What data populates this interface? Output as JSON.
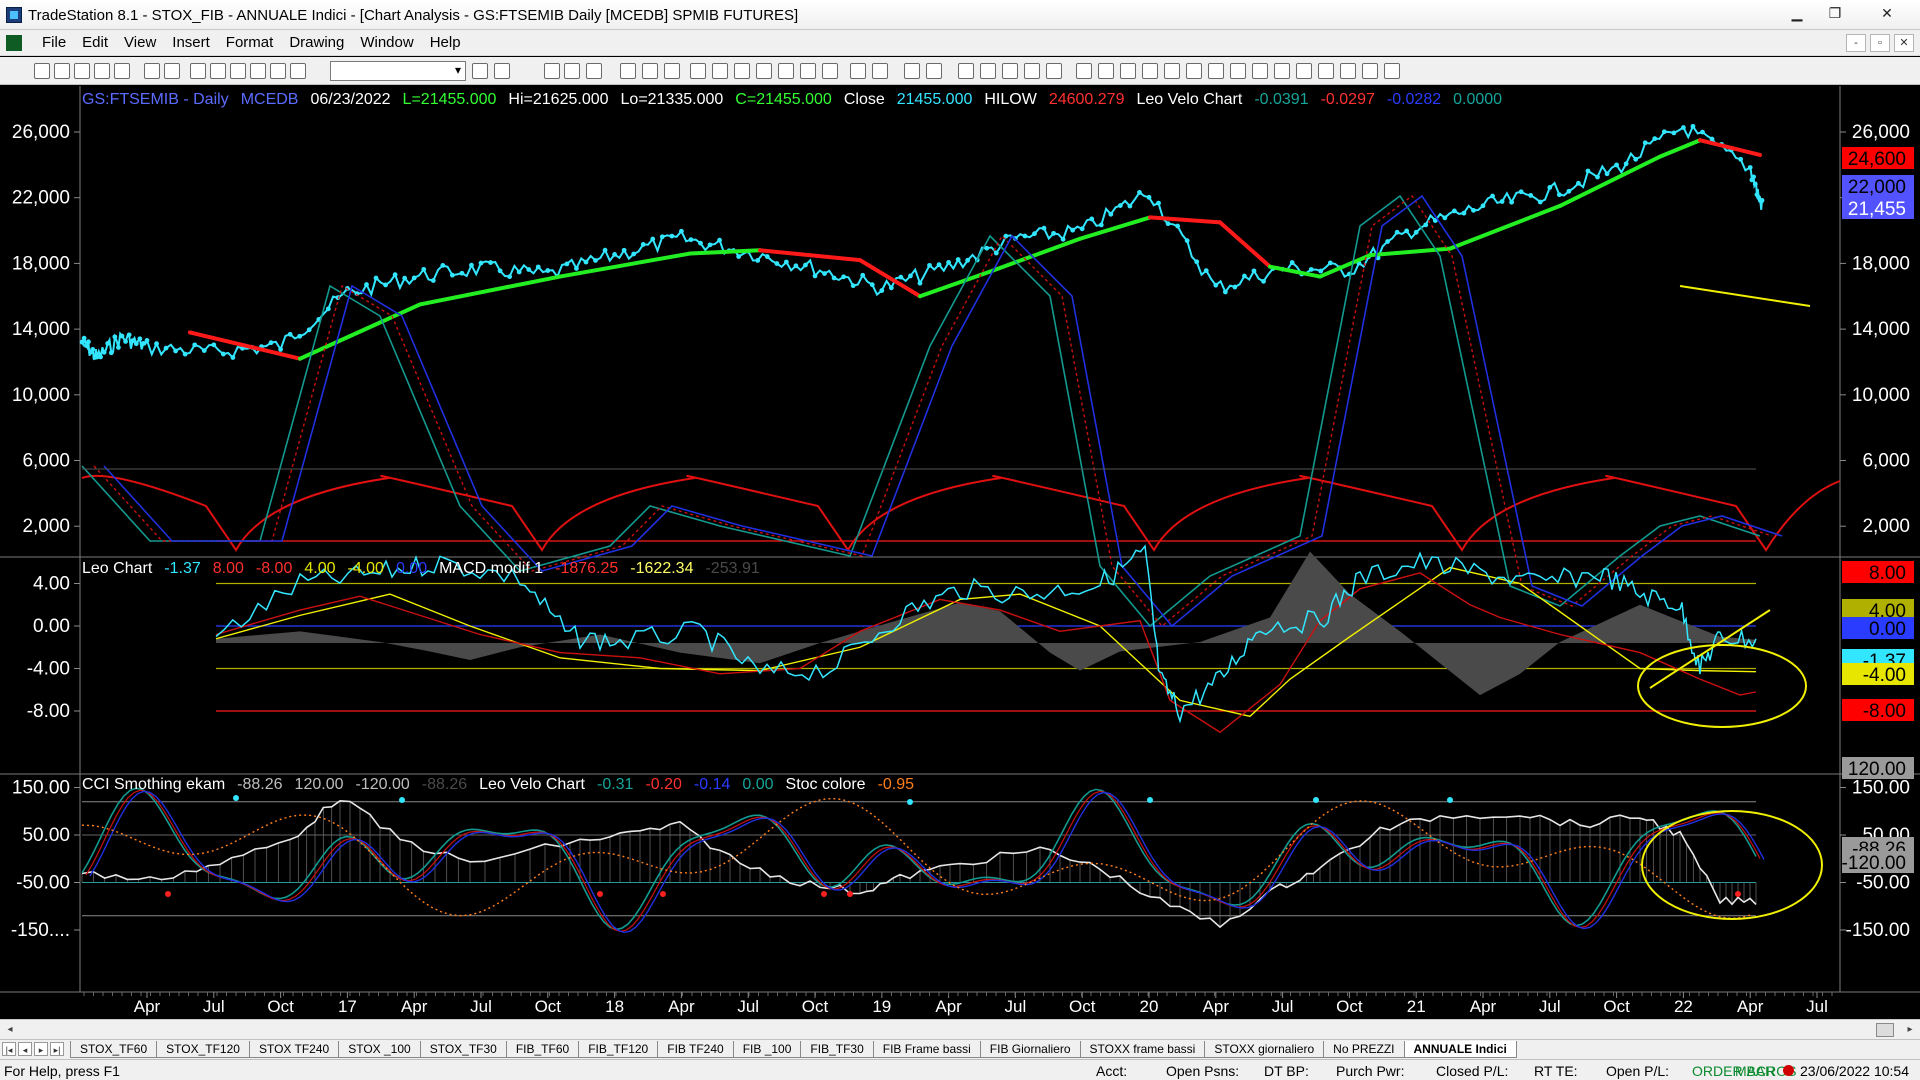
{
  "window": {
    "title": "TradeStation 8.1 - STOX_FIB - ANNUALE Indici - [Chart Analysis - GS:FTSEMIB  Daily  [MCEDB] SPMIB FUTURES]",
    "minimize": "▁",
    "restore": "❐",
    "close": "✕"
  },
  "menu": {
    "items": [
      "File",
      "Edit",
      "View",
      "Insert",
      "Format",
      "Drawing",
      "Window",
      "Help"
    ],
    "mdi": [
      "-",
      "▫",
      "✕"
    ]
  },
  "toolbar": {
    "symbol_value": ""
  },
  "chart": {
    "price_panel": {
      "header": [
        {
          "text": "GS:FTSEMIB - Daily",
          "color": "#5c6bff"
        },
        {
          "text": "MCEDB",
          "color": "#5c6bff"
        },
        {
          "text": "06/23/2022",
          "color": "#ffffff"
        },
        {
          "text": "L=21455.000",
          "color": "#33ff33"
        },
        {
          "text": "Hi=21625.000",
          "color": "#ffffff"
        },
        {
          "text": "Lo=21335.000",
          "color": "#ffffff"
        },
        {
          "text": "C=21455.000",
          "color": "#33ff33"
        },
        {
          "text": "Close",
          "color": "#ffffff"
        },
        {
          "text": "21455.000",
          "color": "#33e6ff"
        },
        {
          "text": "HILOW",
          "color": "#ffffff"
        },
        {
          "text": "24600.279",
          "color": "#ff3030"
        },
        {
          "text": "Leo Velo Chart",
          "color": "#ffffff"
        },
        {
          "text": "-0.0391",
          "color": "#16a59a"
        },
        {
          "text": "-0.0297",
          "color": "#ff3030"
        },
        {
          "text": "-0.0282",
          "color": "#2a3cff"
        },
        {
          "text": "0.0000",
          "color": "#16a59a"
        }
      ],
      "y_ticks": [
        "26,000",
        "22,000",
        "18,000",
        "14,000",
        "10,000",
        "6,000",
        "2,000"
      ],
      "right_ticks": [
        "26,000",
        "22,000",
        "18,000",
        "14,000",
        "10,000",
        "6,000",
        "2,000"
      ],
      "badges": [
        {
          "text": "24,600",
          "bg": "#ff0000",
          "fg": "#000000"
        },
        {
          "text": "22,000",
          "bg": "#5252ff",
          "fg": "#000000"
        },
        {
          "text": "21,455",
          "bg": "#5252ff",
          "fg": "#ffffff"
        }
      ]
    },
    "osc_panel": {
      "header": [
        {
          "text": "Leo Chart",
          "color": "#ffffff"
        },
        {
          "text": "-1.37",
          "color": "#33e6ff"
        },
        {
          "text": "8.00",
          "color": "#ff3030"
        },
        {
          "text": "-8.00",
          "color": "#ff3030"
        },
        {
          "text": "4.00",
          "color": "#e6e600"
        },
        {
          "text": "-4.00",
          "color": "#e6e600"
        },
        {
          "text": "0.00",
          "color": "#2a3cff"
        },
        {
          "text": "MACD modif 1",
          "color": "#ffffff"
        },
        {
          "text": "-1876.25",
          "color": "#ff3030"
        },
        {
          "text": "-1622.34",
          "color": "#ffff66"
        },
        {
          "text": "-253.91",
          "color": "#4a4a4a"
        }
      ],
      "y_ticks": [
        "4.00",
        "0.00",
        "-4.00",
        "-8.00"
      ],
      "badges": [
        {
          "text": "8.00",
          "bg": "#ff0000",
          "fg": "#000000"
        },
        {
          "text": "4.00",
          "bg": "#b0b000",
          "fg": "#000000"
        },
        {
          "text": "0.00",
          "bg": "#2a3cff",
          "fg": "#000000"
        },
        {
          "text": "-1.37",
          "bg": "#33e6ff",
          "fg": "#000000"
        },
        {
          "text": "-4.00",
          "bg": "#e6e600",
          "fg": "#000000"
        },
        {
          "text": "-8.00",
          "bg": "#ff0000",
          "fg": "#000000"
        }
      ]
    },
    "cci_panel": {
      "header": [
        {
          "text": "CCI Smothing ekam",
          "color": "#ffffff"
        },
        {
          "text": "-88.26",
          "color": "#bdbdbd"
        },
        {
          "text": "120.00",
          "color": "#bdbdbd"
        },
        {
          "text": "-120.00",
          "color": "#bdbdbd"
        },
        {
          "text": "-88.26",
          "color": "#4a4a4a"
        },
        {
          "text": "Leo Velo Chart",
          "color": "#ffffff"
        },
        {
          "text": "-0.31",
          "color": "#16a59a"
        },
        {
          "text": "-0.20",
          "color": "#ff3030"
        },
        {
          "text": "-0.14",
          "color": "#2a3cff"
        },
        {
          "text": "0.00",
          "color": "#16a59a"
        },
        {
          "text": "Stoc colore",
          "color": "#ffffff"
        },
        {
          "text": "-0.95",
          "color": "#ff7f1a"
        }
      ],
      "y_ticks": [
        "150.00",
        "50.00",
        "-50.00",
        "-150...."
      ],
      "right_ticks": [
        "150.00",
        "50.00",
        "-50.00",
        "-150.00"
      ],
      "badges": [
        {
          "text": "120.00",
          "bg": "#9a9a9a",
          "fg": "#000000"
        },
        {
          "text": "-88.26",
          "bg": "#9a9a9a",
          "fg": "#000000"
        },
        {
          "text": "-120.00",
          "bg": "#9a9a9a",
          "fg": "#000000"
        }
      ]
    },
    "x_labels": [
      "Apr",
      "Jul",
      "Oct",
      "17",
      "Apr",
      "Jul",
      "Oct",
      "18",
      "Apr",
      "Jul",
      "Oct",
      "19",
      "Apr",
      "Jul",
      "Oct",
      "20",
      "Apr",
      "Jul",
      "Oct",
      "21",
      "Apr",
      "Jul",
      "Oct",
      "22",
      "Apr",
      "Jul"
    ],
    "colors": {
      "price": "#33e6ff",
      "ma_up": "#22ee22",
      "ma_down": "#ff1a1a",
      "cycle": "#e01010",
      "osc_teal": "#139a90",
      "osc_red": "#cc1010",
      "osc_blue": "#2030e0",
      "yellow": "#f0f000",
      "grid": "#8a8a8a"
    }
  },
  "chart_data": {
    "type": "line",
    "title": "GS:FTSEMIB - Daily",
    "x": [
      "Apr",
      "Jul",
      "Oct",
      "17",
      "Apr",
      "Jul",
      "Oct",
      "18",
      "Apr",
      "Jul",
      "Oct",
      "19",
      "Apr",
      "Jul",
      "Oct",
      "20",
      "Apr",
      "Jul",
      "Oct",
      "21",
      "Apr",
      "Jul",
      "Oct",
      "22",
      "Apr",
      "Jul"
    ],
    "series": [
      {
        "name": "Close",
        "values": [
          13500,
          12600,
          13000,
          16200,
          17200,
          17700,
          17300,
          18500,
          19500,
          18700,
          17700,
          16500,
          17800,
          19500,
          20000,
          22400,
          16500,
          17700,
          17600,
          20200,
          21500,
          22300,
          23800,
          26300,
          23800,
          null
        ]
      }
    ],
    "ylim": [
      0,
      27500
    ],
    "last": {
      "date": "06/23/2022",
      "close": 21455,
      "high": 21625,
      "low": 21335
    }
  },
  "bottom": {
    "tabs": [
      "STOX_TF60",
      "STOX_TF120",
      "STOX TF240",
      "STOX _100",
      "STOX_TF30",
      "FIB_TF60",
      "FIB_TF120",
      "FIB TF240",
      "FIB _100",
      "FIB_TF30",
      "FIB Frame bassi",
      "FIB Giornaliero",
      "STOXX frame bassi",
      "STOXX giornaliero",
      "No PREZZI",
      "ANNUALE Indici"
    ],
    "active_tab": "ANNUALE Indici",
    "nav": [
      "|◂",
      "◂",
      "▸",
      "▸|"
    ]
  },
  "status": {
    "help": "For Help, press F1",
    "acct": "Acct:",
    "open_psns": "Open Psns:",
    "dt_bp": "DT BP:",
    "purch_pwr": "Purch Pwr:",
    "closed_pl": "Closed P/L:",
    "rt_te": "RT TE:",
    "open_pl": "Open P/L:",
    "order_bar": "ORDER BAR",
    "macros": "MACROS",
    "datetime": "23/06/2022 10:54"
  }
}
